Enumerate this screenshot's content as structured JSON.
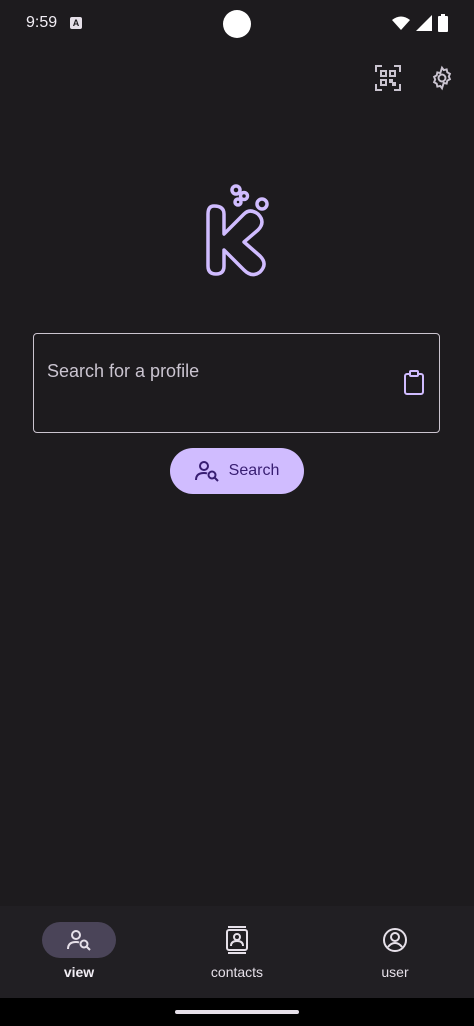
{
  "status_bar": {
    "time": "9:59",
    "notification_icon": "A"
  },
  "top_actions": {
    "qr_icon": "qr-scan-icon",
    "settings_icon": "gear-icon"
  },
  "search": {
    "placeholder": "Search for a profile",
    "button_label": "Search"
  },
  "nav": {
    "items": [
      {
        "label": "view",
        "active": true
      },
      {
        "label": "contacts",
        "active": false
      },
      {
        "label": "user",
        "active": false
      }
    ]
  },
  "colors": {
    "background": "#1d1b1e",
    "accent": "#d0bcff",
    "on_accent": "#381e72"
  }
}
